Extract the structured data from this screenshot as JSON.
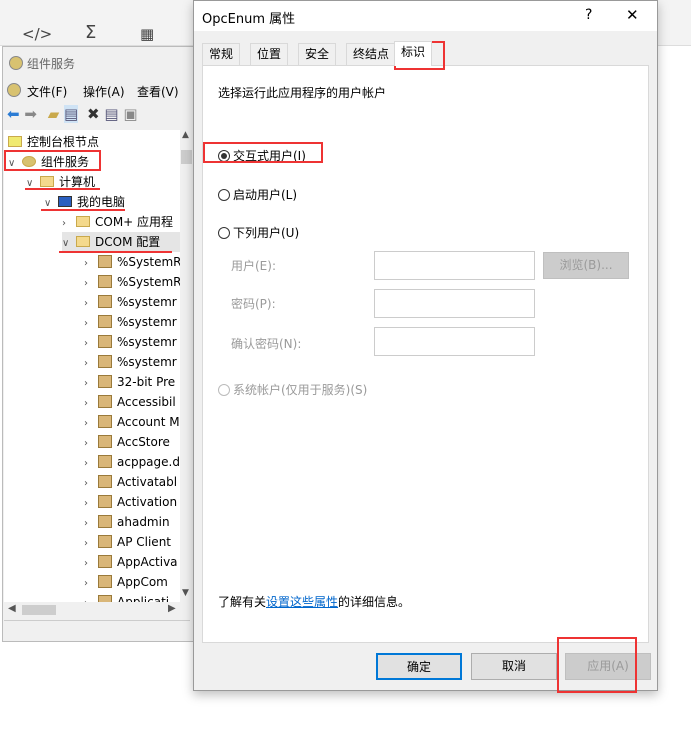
{
  "background_toolbar": {
    "icons": [
      "code-icon",
      "sigma-icon",
      "table-icon"
    ],
    "labels": [
      "</>",
      "Σ",
      "▦"
    ]
  },
  "component_services": {
    "title": "组件服务",
    "menu": [
      "文件(F)",
      "操作(A)",
      "查看(V)"
    ],
    "toolbar_icons": [
      "back-icon",
      "forward-icon",
      "up-folder-icon",
      "show-hide-tree-icon",
      "delete-icon",
      "properties-icon",
      "refresh-icon"
    ],
    "tree": {
      "root": "控制台根节点",
      "component_services": "组件服务",
      "computers": "计算机",
      "my_computer": "我的电脑",
      "com_plus": "COM+ 应用程",
      "dcom_config": "DCOM 配置",
      "dcom_items": [
        "%SystemR",
        "%SystemR",
        "%systemr",
        "%systemr",
        "%systemr",
        "%systemr",
        "32-bit Pre",
        "Accessibil",
        "Account M",
        "AccStore",
        "acppage.d",
        "Activatabl",
        "Activation",
        "ahadmin",
        "AP Client",
        "AppActiva",
        "AppCom",
        "Applicati"
      ]
    }
  },
  "dialog": {
    "title": "OpcEnum 属性",
    "help": "?",
    "close": "✕",
    "tabs": [
      "常规",
      "位置",
      "安全",
      "终结点",
      "标识"
    ],
    "active_tab": "标识",
    "prompt": "选择运行此应用程序的用户帐户",
    "options": {
      "interactive": "交互式用户(I)",
      "launching": "启动用户(L)",
      "this_user": "下列用户(U)",
      "system": "系统帐户(仅用于服务)(S)"
    },
    "selected": "interactive",
    "fields": {
      "user_label": "用户(E):",
      "user_value": "",
      "password_label": "密码(P):",
      "password_value": "",
      "confirm_label": "确认密码(N):",
      "confirm_value": ""
    },
    "browse": "浏览(B)...",
    "info_prefix": "了解有关",
    "info_link": "设置这些属性",
    "info_suffix": "的详细信息。",
    "ok": "确定",
    "cancel": "取消",
    "apply": "应用(A)"
  },
  "colors": {
    "highlight": "#e33333",
    "link": "#0066cc",
    "focus": "#0078d7"
  }
}
